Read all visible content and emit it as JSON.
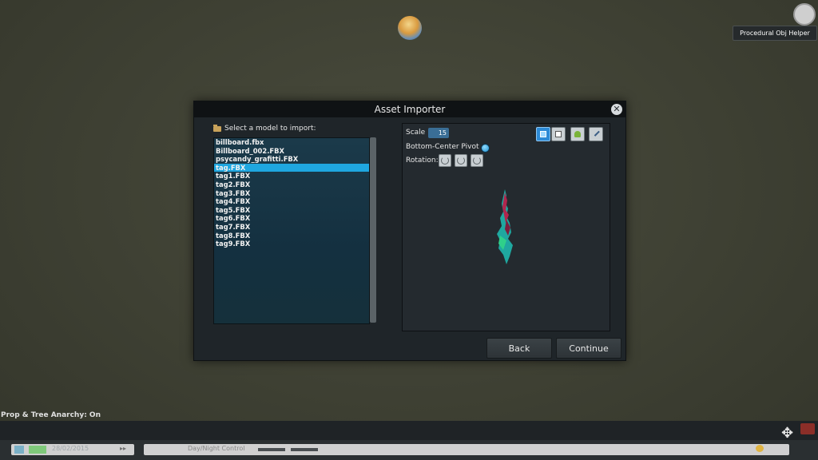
{
  "hud": {
    "procedural_obj_helper": "Procedural Obj Helper",
    "anarchy_status": "Prop & Tree Anarchy: On",
    "date": "28/02/2015",
    "speed_arrows": "▸▸",
    "day_night": "Day/Night Control"
  },
  "dialog": {
    "title": "Asset Importer",
    "close_glyph": "✕",
    "select_label": "Select a model to import:",
    "files": [
      "billboard.fbx",
      "Billboard_002.FBX",
      "psycandy_grafitti.FBX",
      "tag.FBX",
      "tag1.FBX",
      "tag2.FBX",
      "tag3.FBX",
      "tag4.FBX",
      "tag5.FBX",
      "tag6.FBX",
      "tag7.FBX",
      "tag8.FBX",
      "tag9.FBX"
    ],
    "selected_file": "tag.FBX",
    "scale_label": "Scale",
    "scale_value": "15",
    "pivot_label": "Bottom-Center Pivot",
    "rotation_label": "Rotation:",
    "back_label": "Back",
    "continue_label": "Continue"
  },
  "colors": {
    "selection": "#1fa7e0",
    "dialog_bg": "#1f2529",
    "list_bg": "#163445"
  },
  "icons": [
    "folder-icon",
    "close-icon",
    "rotate-x-icon",
    "rotate-y-icon",
    "rotate-z-icon",
    "view-texture-icon",
    "view-box-icon",
    "view-terrain-icon",
    "view-tool-icon",
    "move-icon",
    "weather-icon"
  ]
}
